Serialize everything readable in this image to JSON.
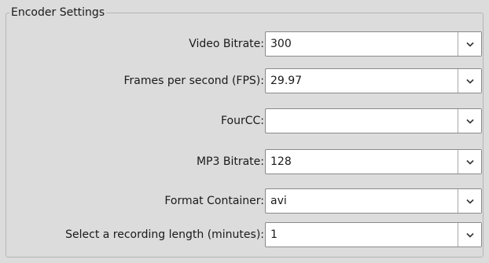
{
  "group": {
    "title": "Encoder Settings"
  },
  "fields": [
    {
      "label": "Video Bitrate:",
      "value": "300"
    },
    {
      "label": "Frames per second (FPS):",
      "value": "29.97"
    },
    {
      "label": "FourCC:",
      "value": ""
    },
    {
      "label": "MP3 Bitrate:",
      "value": "128"
    },
    {
      "label": "Format Container:",
      "value": "avi"
    },
    {
      "label": "Select a recording length (minutes):",
      "value": "1"
    }
  ],
  "icons": {
    "dropdown": "chevron-down-icon"
  },
  "colors": {
    "background": "#dcdcdc",
    "field_background": "#ffffff",
    "field_border": "#8a8a8a"
  }
}
